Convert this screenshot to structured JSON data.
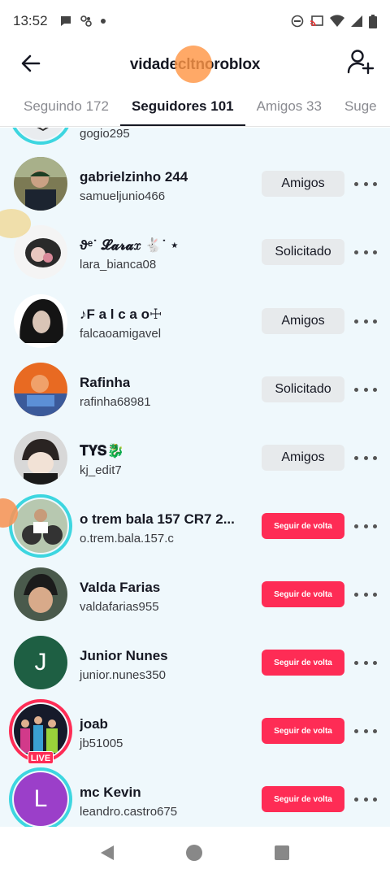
{
  "status_bar": {
    "time": "13:52",
    "notif_icons": [
      "chat-bubble-icon",
      "pinwheel-icon",
      "dot-icon"
    ],
    "system_icons": [
      "dnd-icon",
      "cast-icon",
      "wifi-icon",
      "signal-icon",
      "battery-icon"
    ]
  },
  "header": {
    "title": "vidadecltnoroblox",
    "back_icon": "arrow-left-icon",
    "add_icon": "add-user-icon"
  },
  "tabs": [
    {
      "label": "Seguindo 172",
      "active": false
    },
    {
      "label": "Seguidores 101",
      "active": true
    },
    {
      "label": "Amigos 33",
      "active": false
    },
    {
      "label": "Suge",
      "active": false
    }
  ],
  "followers": [
    {
      "name": "",
      "handle": "gogio295",
      "button": "",
      "button_style": "none",
      "ring": "cyan"
    },
    {
      "name": "gabrielzinho 244",
      "handle": "samueljunio466",
      "button": "Amigos",
      "button_style": "gray"
    },
    {
      "name": "ϑᵉ˙ 𝓛𝓪𝓻𝓪𝑥 🐇˙ ⋆",
      "handle": "lara_bianca08",
      "button": "Solicitado",
      "button_style": "gray"
    },
    {
      "name": "♪F a l c a o☩",
      "handle": "falcaoamigavel",
      "button": "Amigos",
      "button_style": "gray"
    },
    {
      "name": "Rafinha",
      "handle": "rafinha68981",
      "button": "Solicitado",
      "button_style": "gray"
    },
    {
      "name": "𝐓𝐘𝐒🐉",
      "handle": "kj_edit7",
      "button": "Amigos",
      "button_style": "gray"
    },
    {
      "name": "o trem bala 157 CR7 2...",
      "handle": "o.trem.bala.157.c",
      "button": "Seguir de volta",
      "button_style": "red",
      "ring": "cyan"
    },
    {
      "name": "Valda Farias",
      "handle": "valdafarias955",
      "button": "Seguir de volta",
      "button_style": "red"
    },
    {
      "name": "Junior Nunes",
      "handle": "junior.nunes350",
      "button": "Seguir de volta",
      "button_style": "red",
      "avatar_letter": "J"
    },
    {
      "name": "joab",
      "handle": "jb51005",
      "button": "Seguir de volta",
      "button_style": "red",
      "ring": "live",
      "live_label": "LIVE"
    },
    {
      "name": "mc Kevin",
      "handle": "leandro.castro675",
      "button": "Seguir de volta",
      "button_style": "red",
      "ring": "cyan",
      "avatar_letter": "L"
    }
  ],
  "colors": {
    "accent_red": "#fe2c55",
    "ring_cyan": "#3dd6e0",
    "list_bg": "#eff8fc",
    "avatar_j": "#1e5f43",
    "avatar_l": "#9b3fc9"
  },
  "nav_bar": {
    "icons": [
      "nav-back-icon",
      "nav-home-icon",
      "nav-recents-icon"
    ]
  }
}
